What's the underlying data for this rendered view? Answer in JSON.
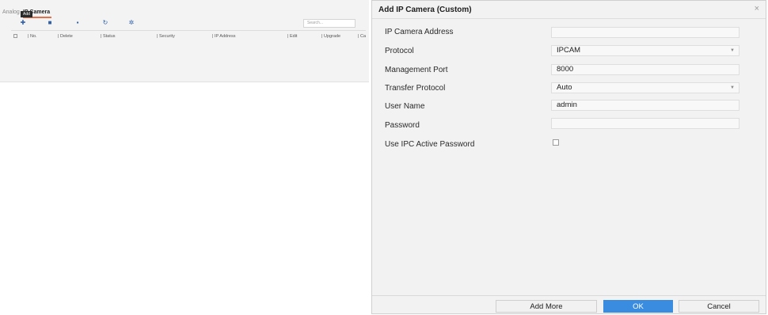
{
  "background": {
    "tabs": {
      "analog": "Analog",
      "ip_camera": "IP Camera"
    },
    "tooltip": "Add",
    "toolbar_icons": [
      "add-icon",
      "delete-icon",
      "list-icon",
      "refresh-icon",
      "settings-icon"
    ],
    "search": {
      "placeholder": "Search..."
    },
    "columns": [
      "No.",
      "Delete",
      "Status",
      "Security",
      "IP Address",
      "Edit",
      "Upgrade",
      "Ca"
    ]
  },
  "dialog": {
    "title": "Add IP Camera (Custom)",
    "close": "×",
    "fields": {
      "ip_address": {
        "label": "IP Camera Address",
        "value": ""
      },
      "protocol": {
        "label": "Protocol",
        "value": "IPCAM"
      },
      "management_port": {
        "label": "Management Port",
        "value": "8000"
      },
      "transfer_protocol": {
        "label": "Transfer Protocol",
        "value": "Auto"
      },
      "user_name": {
        "label": "User Name",
        "value": "admin"
      },
      "password": {
        "label": "Password",
        "value": ""
      },
      "use_ipc_active_password": {
        "label": "Use IPC Active Password",
        "checked": false
      }
    },
    "buttons": {
      "add_more": "Add More",
      "ok": "OK",
      "cancel": "Cancel"
    },
    "colors": {
      "ok_button": "#3a8ce0"
    }
  }
}
